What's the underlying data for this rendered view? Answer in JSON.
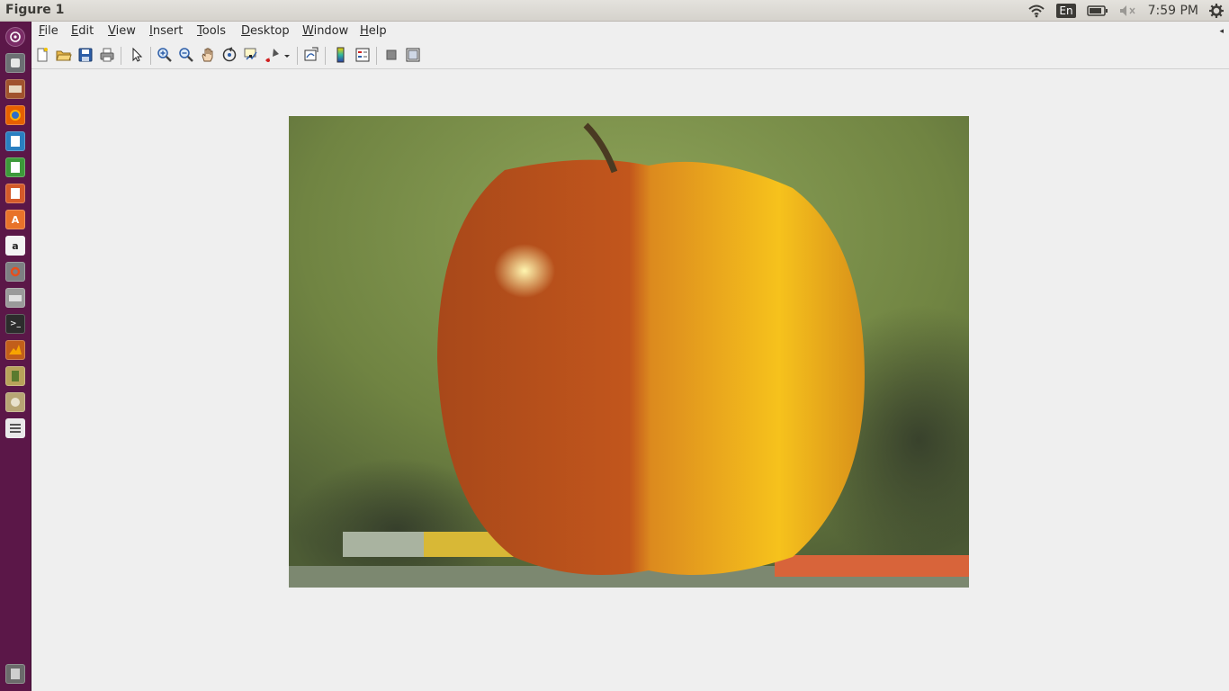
{
  "window": {
    "title": "Figure 1"
  },
  "top_panel": {
    "language": "En",
    "clock": "7:59 PM",
    "indicators": [
      "wifi-icon",
      "keyboard-language",
      "battery-icon",
      "volume-muted-icon",
      "clock",
      "settings-gear-icon"
    ]
  },
  "launcher": {
    "items": [
      "dash-home",
      "files",
      "file-manager",
      "firefox",
      "writer",
      "calc",
      "impress",
      "software-center",
      "amazon",
      "system-settings",
      "printer",
      "terminal",
      "matlab",
      "usb-drive",
      "disk",
      "text-editor",
      "trash"
    ]
  },
  "menubar": {
    "items": [
      {
        "u": "F",
        "rest": "ile"
      },
      {
        "u": "E",
        "rest": "dit"
      },
      {
        "u": "V",
        "rest": "iew"
      },
      {
        "u": "I",
        "rest": "nsert"
      },
      {
        "u": "T",
        "rest": "ools"
      },
      {
        "u": "D",
        "rest": "esktop"
      },
      {
        "u": "W",
        "rest": "indow"
      },
      {
        "u": "H",
        "rest": "elp"
      }
    ]
  },
  "toolbar": {
    "buttons": [
      "new-figure",
      "open-file",
      "save",
      "print",
      "edit-plot",
      "zoom-in",
      "zoom-out",
      "pan",
      "rotate-3d",
      "data-cursor",
      "brush",
      "link-plot",
      "insert-colorbar",
      "insert-legend",
      "hide-plot-tools",
      "show-plot-tools"
    ]
  },
  "figure": {
    "content": "apple-orange-blend-image",
    "colors": {
      "background": "#7a8a45",
      "apple": "#c2541c",
      "orange": "#f0a81c"
    }
  }
}
